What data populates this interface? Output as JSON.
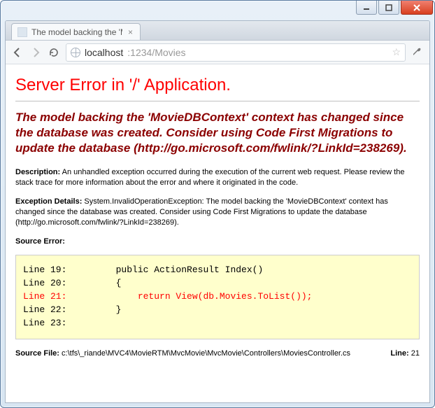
{
  "tab": {
    "title": "The model backing the 'M"
  },
  "url": {
    "host": "localhost",
    "port_path": ":1234/Movies"
  },
  "error": {
    "title": "Server Error in '/' Application.",
    "message": "The model backing the 'MovieDBContext' context has changed since the database was created. Consider using Code First Migrations to update the database (http://go.microsoft.com/fwlink/?LinkId=238269).",
    "description_label": "Description:",
    "description_text": " An unhandled exception occurred during the execution of the current web request. Please review the stack trace for more information about the error and where it originated in the code.",
    "details_label": "Exception Details:",
    "details_text": " System.InvalidOperationException: The model backing the 'MovieDBContext' context has changed since the database was created. Consider using Code First Migrations to update the database (http://go.microsoft.com/fwlink/?LinkId=238269).",
    "source_error_label": "Source Error:",
    "code": {
      "l19": "Line 19:         public ActionResult Index()",
      "l20": "Line 20:         {",
      "l21": "Line 21:             return View(db.Movies.ToList());",
      "l22": "Line 22:         }",
      "l23": "Line 23:"
    },
    "source_file_label": "Source File: ",
    "source_file": "c:\\tfs\\_riande\\MVC4\\MovieRTM\\MvcMovie\\MvcMovie\\Controllers\\MoviesController.cs",
    "line_label": "Line: ",
    "line_number": "21"
  }
}
